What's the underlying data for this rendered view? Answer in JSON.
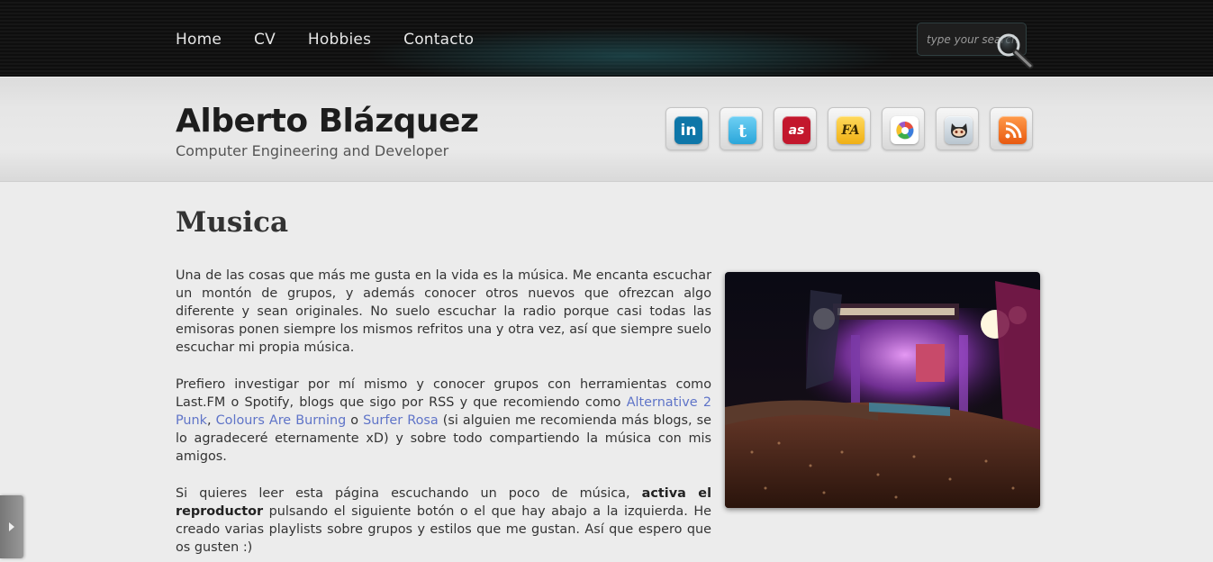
{
  "nav": {
    "items": [
      {
        "label": "Home"
      },
      {
        "label": "CV"
      },
      {
        "label": "Hobbies"
      },
      {
        "label": "Contacto"
      }
    ]
  },
  "search": {
    "placeholder": "type your search",
    "icon": "magnifier-icon"
  },
  "header": {
    "title": "Alberto Blázquez",
    "subtitle": "Computer Engineering and Developer",
    "social": [
      {
        "icon": "linkedin-icon",
        "glyph": "in",
        "color": "#0e76a8"
      },
      {
        "icon": "twitter-icon",
        "glyph": "t",
        "color": "#41b7e8"
      },
      {
        "icon": "lastfm-icon",
        "glyph": "as",
        "color": "#c3172d"
      },
      {
        "icon": "fa-icon",
        "glyph": "FA",
        "color": "#f3b61a"
      },
      {
        "icon": "picasa-icon",
        "glyph": "",
        "color": "#ffffff"
      },
      {
        "icon": "github-icon",
        "glyph": "",
        "color": "#d4dde6"
      },
      {
        "icon": "rss-icon",
        "glyph": "",
        "color": "#f26b1d"
      }
    ]
  },
  "main": {
    "heading": "Musica",
    "p1": "Una de las cosas que más me gusta en la vida es la música. Me encanta escuchar un montón de grupos, y además conocer otros nuevos que ofrezcan algo diferente y sean originales. No suelo escuchar la radio porque casi todas las emisoras ponen siempre los mismos refritos una y otra vez, así que siempre suelo escuchar mi propia música.",
    "p2_a": "Prefiero investigar por mí mismo y conocer grupos con herramientas como Last.FM o Spotify, blogs que sigo por RSS y que recomiendo como ",
    "link1": "Alternative 2 Punk",
    "p2_b": ", ",
    "link2": "Colours Are Burning",
    "p2_c": " o ",
    "link3": "Surfer Rosa",
    "p2_d": " (si alguien me recomienda más blogs, se lo agradeceré eternamente xD) y sobre todo compartiendo la música con mis amigos.",
    "p3_a": "Si quieres leer esta página escuchando un poco de música, ",
    "p3_bold": "activa el reproductor",
    "p3_b": " pulsando el siguiente botón o el que hay abajo a la izquierda. He creado varias playlists sobre grupos y estilos que me gustan. Así que espero que os gusten :)",
    "photo_icon": "concert-photo"
  },
  "colors": {
    "link": "#5f74c8",
    "topbar": "#111111",
    "accent_glow": "#287882"
  }
}
